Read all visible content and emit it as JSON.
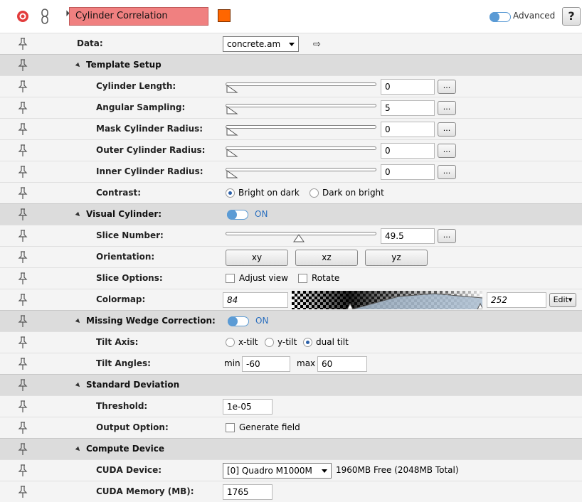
{
  "header": {
    "title": "Cylinder Correlation",
    "color": "#ff6600",
    "advanced_label": "Advanced",
    "help_label": "?"
  },
  "data": {
    "label": "Data:",
    "value": "concrete.am"
  },
  "template_setup": {
    "label": "Template Setup",
    "cylinder_length": {
      "label": "Cylinder Length:",
      "value": "0"
    },
    "angular_sampling": {
      "label": "Angular Sampling:",
      "value": "5"
    },
    "mask_cylinder_radius": {
      "label": "Mask Cylinder Radius:",
      "value": "0"
    },
    "outer_cylinder_radius": {
      "label": "Outer Cylinder Radius:",
      "value": "0"
    },
    "inner_cylinder_radius": {
      "label": "Inner Cylinder Radius:",
      "value": "0"
    },
    "contrast": {
      "label": "Contrast:",
      "options": [
        "Bright on dark",
        "Dark on bright"
      ],
      "selected": "Bright on dark"
    },
    "dots_label": "..."
  },
  "visual_cylinder": {
    "label": "Visual Cylinder:",
    "toggle_label": "ON",
    "slice_number": {
      "label": "Slice Number:",
      "value": "49.5"
    },
    "orientation": {
      "label": "Orientation:",
      "options": [
        "xy",
        "xz",
        "yz"
      ]
    },
    "slice_options": {
      "label": "Slice Options:",
      "adjust_view": "Adjust view",
      "rotate": "Rotate"
    },
    "colormap": {
      "label": "Colormap:",
      "min": "84",
      "max": "252",
      "edit_label": "Edit"
    }
  },
  "missing_wedge": {
    "label": "Missing Wedge Correction:",
    "toggle_label": "ON",
    "tilt_axis": {
      "label": "Tilt Axis:",
      "options": [
        "x-tilt",
        "y-tilt",
        "dual tilt"
      ],
      "selected": "dual tilt"
    },
    "tilt_angles": {
      "label": "Tilt Angles:",
      "min_label": "min",
      "min": "-60",
      "max_label": "max",
      "max": "60"
    }
  },
  "standard_deviation": {
    "label": "Standard Deviation",
    "threshold": {
      "label": "Threshold:",
      "value": "1e-05"
    },
    "output_option": {
      "label": "Output Option:",
      "checkbox": "Generate field"
    }
  },
  "compute_device": {
    "label": "Compute Device",
    "cuda_device": {
      "label": "CUDA Device:",
      "value": "[0] Quadro M1000M",
      "info": "1960MB Free (2048MB Total)"
    },
    "cuda_memory": {
      "label": "CUDA Memory (MB):",
      "value": "1765"
    }
  }
}
